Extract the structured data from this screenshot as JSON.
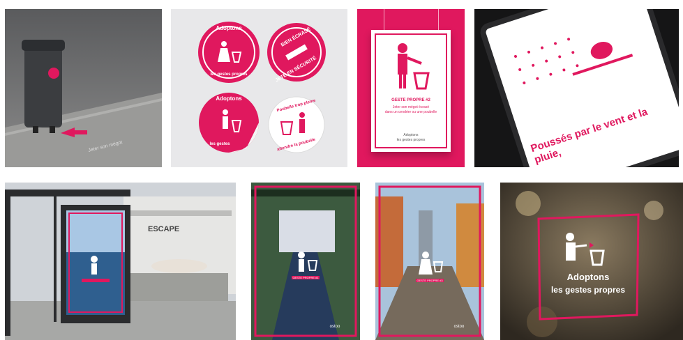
{
  "colors": {
    "accent": "#e0185e",
    "white": "#ffffff",
    "dark": "#1d1d1f"
  },
  "stickers": {
    "s1": {
      "line1": "Adoptons",
      "line2": "les gestes propres"
    },
    "s2": {
      "line1": "BIEN ÉCRASÉ",
      "line2": "JETÉ EN SÉCURITÉ"
    },
    "s3": {
      "line1": "Adoptons",
      "line2": "les gestes"
    },
    "s4": {
      "line1": "Poubelle trop pleine",
      "line2": "attendre la poubelle"
    }
  },
  "poster_a4": {
    "headline": "GESTE PROPRE #2",
    "body1": "Jeter son mégot écrasé",
    "body2": "dans un cendrier ou une poubelle",
    "footer1": "Adoptons",
    "footer2": "les gestes propres"
  },
  "tablet": {
    "caption": "Poussés par le vent et la pluie,"
  },
  "abribus": {
    "shop_sign": "ESCAPE"
  },
  "poster_b": {
    "headline": "GESTE PROPRE #1",
    "brand": "ostoo"
  },
  "poster_c": {
    "headline": "GESTE PROPRE #3",
    "brand": "ostoo"
  },
  "window_decal": {
    "line1": "Adoptons",
    "line2": "les gestes propres"
  },
  "icons": [
    "trash-bin-icon",
    "person-throwing-icon",
    "arrow-icon"
  ]
}
